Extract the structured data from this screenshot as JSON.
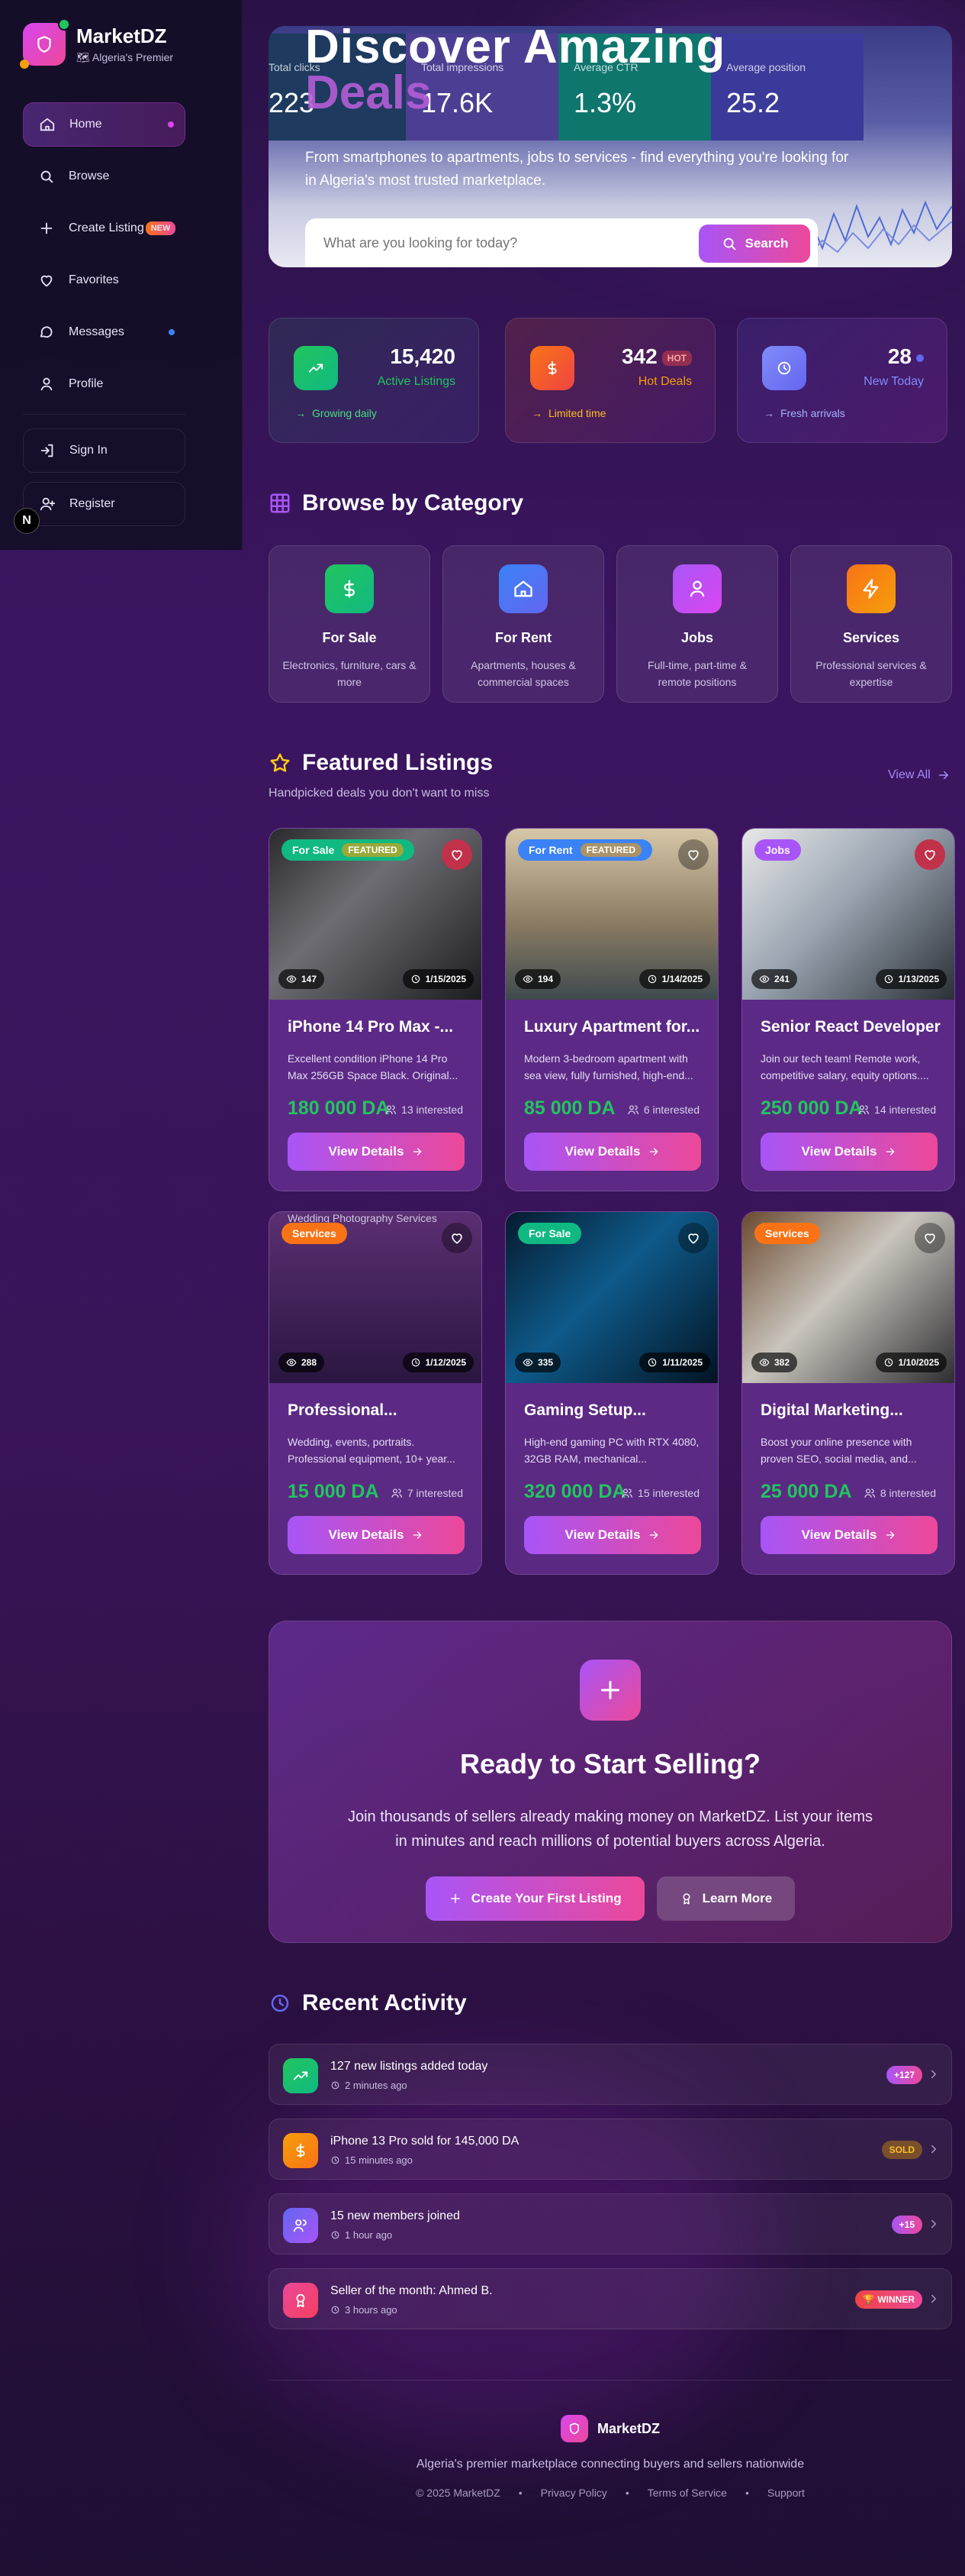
{
  "brand": {
    "name": "MarketDZ",
    "tagline": "Algeria's Premier"
  },
  "sidebar": {
    "items": [
      {
        "label": "Home"
      },
      {
        "label": "Browse"
      },
      {
        "label": "Create Listing",
        "badge": "NEW"
      },
      {
        "label": "Favorites"
      },
      {
        "label": "Messages"
      },
      {
        "label": "Profile"
      }
    ],
    "auth": [
      {
        "label": "Sign In"
      },
      {
        "label": "Register"
      }
    ],
    "corner_badge": "N"
  },
  "hero": {
    "title": "Discover Amazing",
    "title2": "Deals",
    "description": "From smartphones to apartments, jobs to services - find everything you're looking for in Algeria's most trusted marketplace.",
    "search_placeholder": "What are you looking for today?",
    "search_button": "Search",
    "image_tiles": [
      {
        "label": "Total clicks",
        "value": "223"
      },
      {
        "label": "Total impressions",
        "value": "17.6K"
      },
      {
        "label": "Average CTR",
        "value": "1.3%"
      },
      {
        "label": "Average position",
        "value": "25.2"
      }
    ]
  },
  "stats": [
    {
      "value": "15,420",
      "label": "Active Listings",
      "foot": "Growing daily",
      "color": "#22c55e"
    },
    {
      "value": "342",
      "badge": "HOT",
      "label": "Hot Deals",
      "foot": "Limited time",
      "color": "#f59e0b"
    },
    {
      "value": "28",
      "label": "New Today",
      "foot": "Fresh arrivals",
      "color": "#818cf8"
    }
  ],
  "categories_section": {
    "title": "Browse by Category"
  },
  "categories": [
    {
      "name": "For Sale",
      "desc": "Electronics, furniture, cars & more",
      "icon": "dollar-icon"
    },
    {
      "name": "For Rent",
      "desc": "Apartments, houses & commercial spaces",
      "icon": "home-icon"
    },
    {
      "name": "Jobs",
      "desc": "Full-time, part-time & remote positions",
      "icon": "user-icon"
    },
    {
      "name": "Services",
      "desc": "Professional services & expertise",
      "icon": "bolt-icon"
    }
  ],
  "featured": {
    "title": "Featured Listings",
    "subtitle": "Handpicked deals you don't want to miss",
    "view_all": "View All",
    "button_label": "View Details",
    "listings": [
      {
        "tag": "For Sale",
        "featured": "FEATURED",
        "views": "147",
        "date": "1/15/2025",
        "title": "iPhone 14 Pro Max -...",
        "desc": "Excellent condition iPhone 14 Pro Max 256GB Space Black. Original...",
        "price": "180 000 DA",
        "interested": "13 interested",
        "liked": true
      },
      {
        "tag": "For Rent",
        "featured": "FEATURED",
        "views": "194",
        "date": "1/14/2025",
        "title": "Luxury Apartment for...",
        "desc": "Modern 3-bedroom apartment with sea view, fully furnished, high-end...",
        "price": "85 000 DA",
        "interested": "6 interested",
        "liked": false
      },
      {
        "tag": "Jobs",
        "featured": "",
        "views": "241",
        "date": "1/13/2025",
        "title": "Senior React Developer",
        "desc": "Join our tech team! Remote work, competitive salary, equity options....",
        "price": "250 000 DA",
        "interested": "14 interested",
        "liked": true
      },
      {
        "tag": "Services",
        "featured": "",
        "alt": "Wedding Photography Services",
        "views": "288",
        "date": "1/12/2025",
        "title": "Professional...",
        "desc": "Wedding, events, portraits. Professional equipment, 10+ year...",
        "price": "15 000 DA",
        "interested": "7 interested",
        "liked": false
      },
      {
        "tag": "For Sale",
        "featured": "",
        "views": "335",
        "date": "1/11/2025",
        "title": "Gaming Setup...",
        "desc": "High-end gaming PC with RTX 4080, 32GB RAM, mechanical...",
        "price": "320 000 DA",
        "interested": "15 interested",
        "liked": false
      },
      {
        "tag": "Services",
        "featured": "",
        "views": "382",
        "date": "1/10/2025",
        "title": "Digital Marketing...",
        "desc": "Boost your online presence with proven SEO, social media, and...",
        "price": "25 000 DA",
        "interested": "8 interested",
        "liked": false
      }
    ]
  },
  "cta": {
    "title": "Ready to Start Selling?",
    "text": "Join thousands of sellers already making money on MarketDZ. List your items in minutes and reach millions of potential buyers across Algeria.",
    "primary": "Create Your First Listing",
    "secondary": "Learn More"
  },
  "activity": {
    "title": "Recent Activity",
    "items": [
      {
        "text": "127 new listings added today",
        "time": "2 minutes ago",
        "badge": "+127"
      },
      {
        "text": "iPhone 13 Pro sold for 145,000 DA",
        "time": "15 minutes ago",
        "badge": "SOLD"
      },
      {
        "text": "15 new members joined",
        "time": "1 hour ago",
        "badge": "+15"
      },
      {
        "text": "Seller of the month: Ahmed B.",
        "time": "3 hours ago",
        "badge": "WINNER"
      }
    ]
  },
  "footer": {
    "brand": "MarketDZ",
    "desc": "Algeria's premier marketplace connecting buyers and sellers nationwide",
    "copyright": "© 2025 MarketDZ",
    "links": [
      "Privacy Policy",
      "Terms of Service",
      "Support"
    ]
  }
}
